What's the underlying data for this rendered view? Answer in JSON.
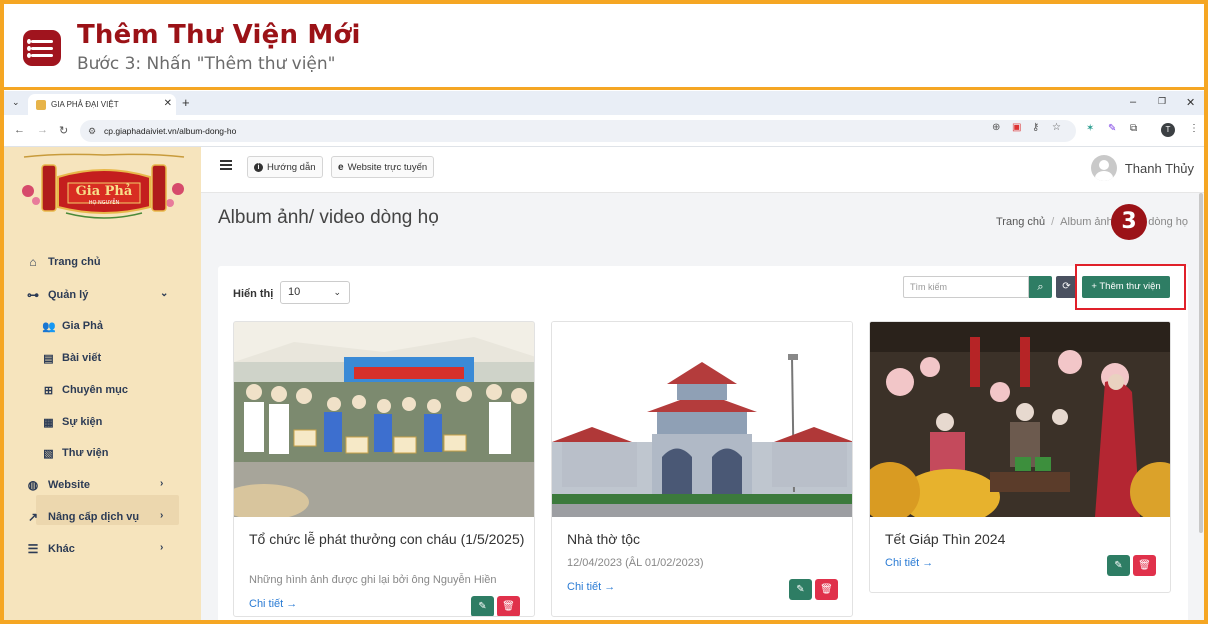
{
  "header": {
    "title": "Thêm Thư Viện Mới",
    "subtitle": "Bước 3: Nhấn \"Thêm thư viện\""
  },
  "browser": {
    "tab_title": "GIA PHẢ ĐẠI VIỆT",
    "url": "cp.giaphadaiviet.vn/album-dong-ho",
    "profile_initial": "T"
  },
  "logo": {
    "text": "Gia Phả",
    "subtext": "HỌ NGUYỄN"
  },
  "sidebar": {
    "items": [
      {
        "label": "Trang chủ",
        "icon": "home-icon"
      },
      {
        "label": "Quản lý",
        "icon": "sitemap-icon"
      },
      {
        "label": "Gia Phả",
        "icon": "users-icon"
      },
      {
        "label": "Bài viết",
        "icon": "newspaper-icon"
      },
      {
        "label": "Chuyên mục",
        "icon": "grid-icon"
      },
      {
        "label": "Sự kiện",
        "icon": "calendar-icon"
      },
      {
        "label": "Thư viện",
        "icon": "images-icon"
      },
      {
        "label": "Website",
        "icon": "globe-icon"
      },
      {
        "label": "Nâng cấp dịch vụ",
        "icon": "chart-icon"
      },
      {
        "label": "Khác",
        "icon": "list-icon"
      }
    ],
    "active": "Thư viện"
  },
  "topnav": {
    "guide": "Hướng dẫn",
    "website": "Website trực tuyến",
    "user": "Thanh Thủy"
  },
  "page": {
    "title": "Album ảnh/ video dòng họ",
    "breadcrumb_home": "Trang chủ",
    "breadcrumb_current": "Album ảnh/ video dòng họ",
    "step_number": "3"
  },
  "toolbar": {
    "show_label": "Hiển thị",
    "page_size": "10",
    "search_placeholder": "Tìm kiếm",
    "add_label": "+ Thêm thư viện"
  },
  "albums": [
    {
      "title": "Tổ chức lễ phát thưởng con cháu (1/5/2025)",
      "desc": "Những hình ảnh được ghi lại bởi ông Nguyễn Hiền",
      "link": "Chi tiết →"
    },
    {
      "title": "Nhà thờ tộc",
      "desc": "12/04/2023 (ÂL 01/02/2023)",
      "link": "Chi tiết →"
    },
    {
      "title": "Tết Giáp Thìn 2024",
      "desc": "",
      "link": "Chi tiết →"
    }
  ],
  "colors": {
    "accent_orange": "#f5a623",
    "title_red": "#9b1217",
    "primary_green": "#2e7d64",
    "danger_red": "#e0314b",
    "sidebar_bg": "#f6e4bd",
    "highlight_red": "#e0202a"
  }
}
